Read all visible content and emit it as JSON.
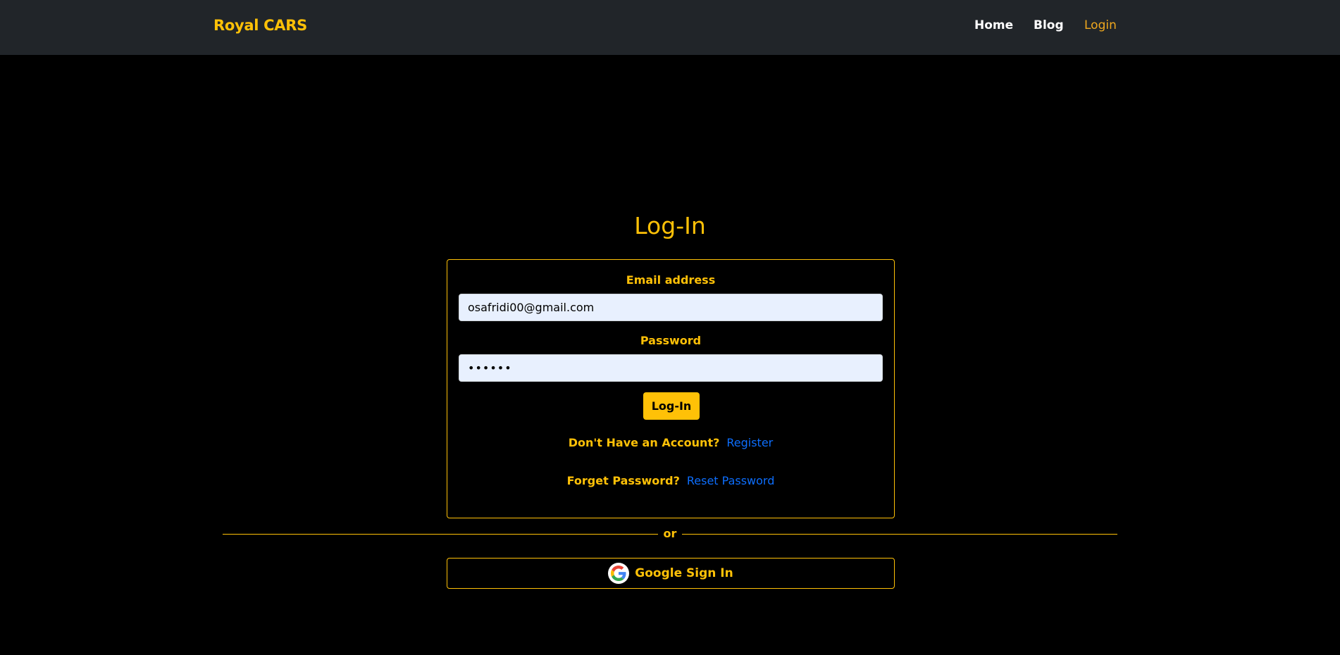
{
  "navbar": {
    "brand": "Royal CARS",
    "links": [
      {
        "label": "Home"
      },
      {
        "label": "Blog"
      },
      {
        "label": "Login",
        "active": true
      }
    ]
  },
  "page": {
    "title": "Log-In"
  },
  "form": {
    "email_label": "Email address",
    "email_value": "osafridi00@gmail.com",
    "password_label": "Password",
    "password_value": "••••••",
    "submit_label": "Log-In",
    "register_prompt": "Don't Have an Account?",
    "register_link": "Register",
    "forgot_prompt": "Forget Password?",
    "reset_link": "Reset Password"
  },
  "divider": {
    "text": "or"
  },
  "google": {
    "label": "Google Sign In",
    "icon": "google-icon"
  },
  "colors": {
    "accent": "#ffc107",
    "navbar_bg": "#212529",
    "page_bg": "#000000",
    "link": "#0d6efd",
    "input_bg": "#e8f0fe"
  }
}
